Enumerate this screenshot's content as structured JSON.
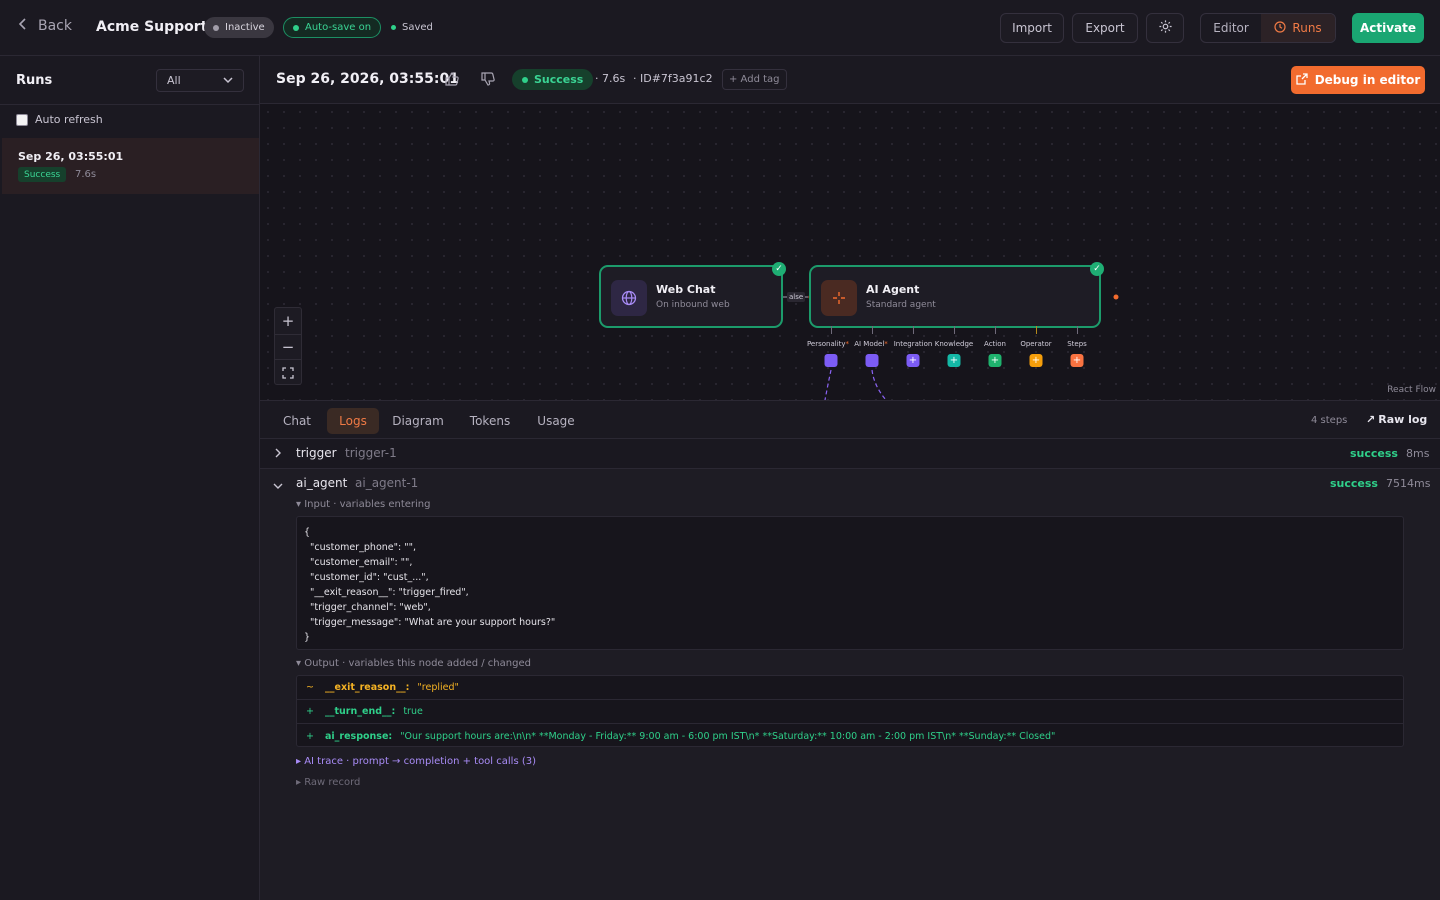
{
  "topbar": {
    "back_label": "Back",
    "title": "Acme Support",
    "status_pill": "Inactive",
    "autosave_pill": "Auto-save on",
    "saved_label": "Saved",
    "import_label": "Import",
    "export_label": "Export",
    "editor_label": "Editor",
    "runs_label": "Runs",
    "activate_label": "Activate"
  },
  "sidebar": {
    "title": "Runs",
    "filter_value": "All",
    "auto_refresh_label": "Auto refresh",
    "runs": [
      {
        "time": "Sep 26, 03:55:01",
        "status": "Success",
        "duration": "7.6s"
      }
    ]
  },
  "run_header": {
    "title": "Sep 26, 2026, 03:55:01",
    "status": "Success",
    "duration": "· 7.6s",
    "run_id": "· ID#7f3a91c2",
    "add_tag_label": "+ Add tag",
    "debug_label": "Debug in editor"
  },
  "canvas": {
    "trigger_node": {
      "title": "Web Chat",
      "subtitle": "On inbound web"
    },
    "edge_label": "alse",
    "agent_node": {
      "title": "AI Agent",
      "subtitle": "Standard agent"
    },
    "ports": [
      {
        "label": "Personality",
        "required": "*",
        "color": "#7c5cf5"
      },
      {
        "label": "AI Model",
        "required": "*",
        "color": "#7c5cf5"
      },
      {
        "label": "Integration",
        "required": "",
        "color": "#7c5cf5"
      },
      {
        "label": "Knowledge",
        "required": "",
        "color": "#14b8a6"
      },
      {
        "label": "Action",
        "required": "",
        "color": "#1fb36e"
      },
      {
        "label": "Operator",
        "required": "",
        "color": "#f59e0b"
      },
      {
        "label": "Steps",
        "required": "",
        "color": "#f97341"
      }
    ],
    "attribution": "React Flow"
  },
  "tabs": {
    "items": [
      "Chat",
      "Logs",
      "Diagram",
      "Tokens",
      "Usage"
    ],
    "active": "Logs",
    "steps_count": "4 steps",
    "raw_log_label": "Raw log"
  },
  "logs": {
    "trigger": {
      "name": "trigger",
      "id": "trigger-1",
      "status": "success",
      "time": "8ms"
    },
    "agent": {
      "name": "ai_agent",
      "id": "ai_agent-1",
      "status": "success",
      "time": "7514ms"
    },
    "input_label": "▾ Input · variables entering",
    "input_lines": [
      "{",
      "  \"customer_phone\": \"\",",
      "  \"customer_email\": \"\",",
      "  \"customer_id\": \"cust_...\",",
      "  \"__exit_reason__\": \"trigger_fired\",",
      "  \"trigger_channel\": \"web\",",
      "  \"trigger_message\": \"What are your support hours?\"",
      "}"
    ],
    "output_label": "▾ Output · variables this node added / changed",
    "output_rows": [
      {
        "sign": "~",
        "key": "__exit_reason__:",
        "value": "\"replied\"",
        "color": "#f5b324"
      },
      {
        "sign": "+",
        "key": "__turn_end__:",
        "value": "true",
        "color": "#2fd08a"
      },
      {
        "sign": "+",
        "key": "ai_response:",
        "value": "\"Our support hours are:\\n\\n*  **Monday - Friday:** 9:00 am - 6:00 pm IST\\n*  **Saturday:** 10:00 am - 2:00 pm IST\\n*  **Sunday:** Closed\"",
        "color": "#2fd08a"
      }
    ],
    "ai_trace_label": "▸ AI trace · prompt → completion + tool calls (3)",
    "raw_record_label": "▸ Raw record"
  },
  "colors": {
    "accent_green": "#1fae74",
    "accent_orange": "#f26b2e",
    "success_text": "#2fd08a"
  }
}
